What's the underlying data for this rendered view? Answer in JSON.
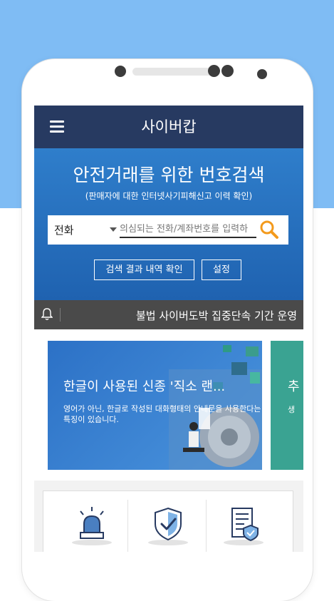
{
  "colors": {
    "background_top": "#7fbcf4",
    "app_bar": "#273a61",
    "hero": "#2f7ecb",
    "notice_bar": "#4a4a4a",
    "search_accent": "#f39a1c"
  },
  "app_bar": {
    "title": "사이버캅",
    "menu_icon": "hamburger-menu-icon"
  },
  "hero": {
    "title": "안전거래를 위한 번호검색",
    "subtitle": "(판매자에 대한 인터넷사기피해신고 이력 확인)"
  },
  "search": {
    "type_selected": "전화",
    "placeholder": "의심되는 전화/계좌번호를 입력하",
    "icon": "search-icon"
  },
  "buttons": {
    "history": "검색 결과 내역 확인",
    "settings": "설정"
  },
  "notice": {
    "icon": "bell-icon",
    "text": "불법 사이버도박 집중단속 기간 운영"
  },
  "banner": {
    "title": "한글이 사용된 신종 '직소 랜...",
    "description": "영어가 아닌, 한글로 작성된 대화형태의 안내문을 사용한다는 특징이 있습니다.",
    "next_title": "추",
    "next_sub": "생"
  },
  "quick_menu": {
    "icons": [
      "siren-icon",
      "shield-check-icon",
      "report-document-icon"
    ]
  }
}
